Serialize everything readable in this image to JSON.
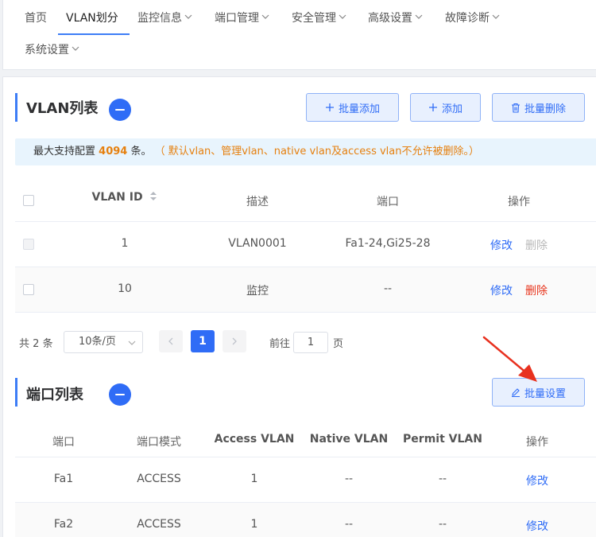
{
  "nav": {
    "items": [
      {
        "label": "首页",
        "dropdown": false,
        "active": false
      },
      {
        "label": "VLAN划分",
        "dropdown": false,
        "active": true
      },
      {
        "label": "监控信息",
        "dropdown": true
      },
      {
        "label": "端口管理",
        "dropdown": true
      },
      {
        "label": "安全管理",
        "dropdown": true
      },
      {
        "label": "高级设置",
        "dropdown": true
      },
      {
        "label": "故障诊断",
        "dropdown": true
      },
      {
        "label": "系统设置",
        "dropdown": true
      }
    ]
  },
  "vlan_section": {
    "title": "VLAN列表",
    "buttons": {
      "bulk_add": "批量添加",
      "add": "添加",
      "bulk_delete": "批量删除"
    },
    "notice": {
      "prefix": "最大支持配置",
      "max": "4094",
      "suffix": "条。",
      "warning": "（ 默认vlan、管理vlan、native vlan及access vlan不允许被删除。）"
    },
    "columns": [
      "VLAN ID",
      "描述",
      "端口",
      "操作"
    ],
    "rows": [
      {
        "id": "1",
        "desc": "VLAN0001",
        "ports": "Fa1-24,Gi25-28",
        "edit": "修改",
        "delete": "删除",
        "delete_enabled": false
      },
      {
        "id": "10",
        "desc": "监控",
        "ports": "--",
        "edit": "修改",
        "delete": "删除",
        "delete_enabled": true
      }
    ],
    "pagination": {
      "total_prefix": "共",
      "total": "2",
      "total_suffix": "条",
      "page_size": "10条/页",
      "current_page": "1",
      "goto_label": "前往",
      "goto_value": "1",
      "goto_suffix": "页"
    }
  },
  "port_section": {
    "title": "端口列表",
    "bulk_button": "批量设置",
    "columns": [
      "端口",
      "端口模式",
      "Access VLAN",
      "Native VLAN",
      "Permit VLAN",
      "操作"
    ],
    "rows": [
      {
        "port": "Fa1",
        "mode": "ACCESS",
        "access": "1",
        "native": "--",
        "permit": "--",
        "action": "修改"
      },
      {
        "port": "Fa2",
        "mode": "ACCESS",
        "access": "1",
        "native": "--",
        "permit": "--",
        "action": "修改"
      }
    ]
  },
  "colors": {
    "primary": "#2f6cf6",
    "warning": "#e6800f",
    "danger": "#e8341c",
    "annotation_arrow": "#e8311f"
  }
}
